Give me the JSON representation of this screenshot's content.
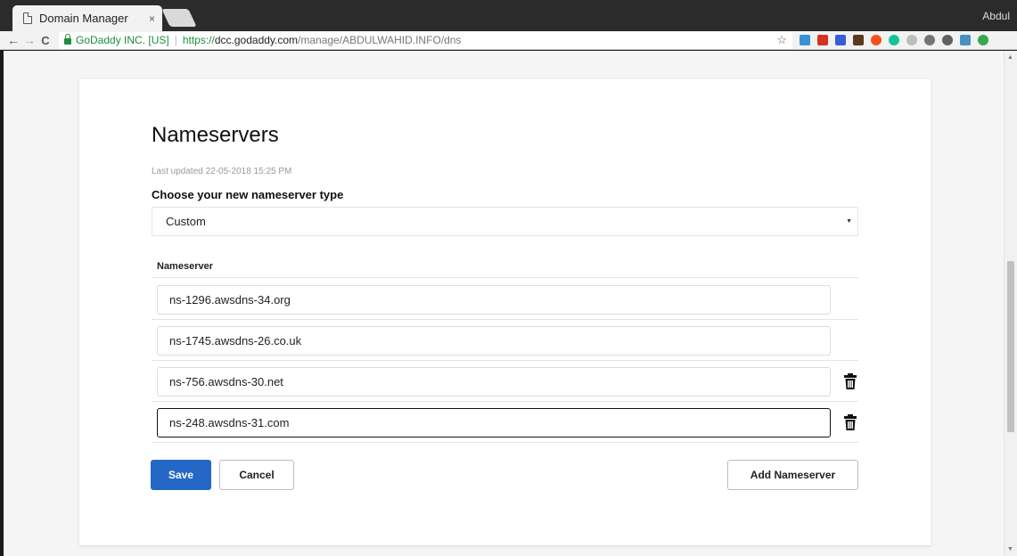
{
  "browser": {
    "tab_title": "Domain Manager",
    "tab_close": "×",
    "profile_name": "Abdul",
    "security_label": "GoDaddy INC. [US]",
    "url_scheme": "https://",
    "url_host": "dcc.godaddy.com",
    "url_path": "/manage/ABDULWAHID.INFO/dns",
    "back_glyph": "←",
    "forward_glyph": "→",
    "reload_glyph": "C",
    "star_glyph": "☆",
    "extensions": [
      {
        "icon": "chart-extension-icon",
        "color": "#3a8fd8"
      },
      {
        "icon": "red-bookmark-icon",
        "color": "#d93025"
      },
      {
        "icon": "blue-square-icon",
        "color": "#3b5bdb"
      },
      {
        "icon": "dark-mask-icon",
        "color": "#5a3a1a"
      },
      {
        "icon": "orange-circle-icon",
        "color": "#f4511e"
      },
      {
        "icon": "grammarly-icon",
        "color": "#15c39a"
      },
      {
        "icon": "shield-icon",
        "color": "#bdbdbd"
      },
      {
        "icon": "camera-icon",
        "color": "#757575"
      },
      {
        "icon": "speedometer-icon",
        "color": "#616161"
      },
      {
        "icon": "image-extension-icon",
        "color": "#4a90c2"
      },
      {
        "icon": "green-circle-icon",
        "color": "#34a853"
      }
    ]
  },
  "page": {
    "title": "Nameservers",
    "last_updated": "Last updated 22-05-2018 15:25 PM",
    "type_label": "Choose your new nameserver type",
    "type_value": "Custom",
    "ns_column_header": "Nameserver",
    "nameservers": [
      {
        "value": "ns-1296.awsdns-34.org"
      },
      {
        "value": "ns-1745.awsdns-26.co.uk"
      },
      {
        "value": "ns-756.awsdns-30.net"
      },
      {
        "value": "ns-248.awsdns-31.com"
      }
    ],
    "save_label": "Save",
    "cancel_label": "Cancel",
    "add_label": "Add Nameserver"
  },
  "colors": {
    "primary": "#2467c7",
    "secure_green": "#1e8e3e"
  }
}
